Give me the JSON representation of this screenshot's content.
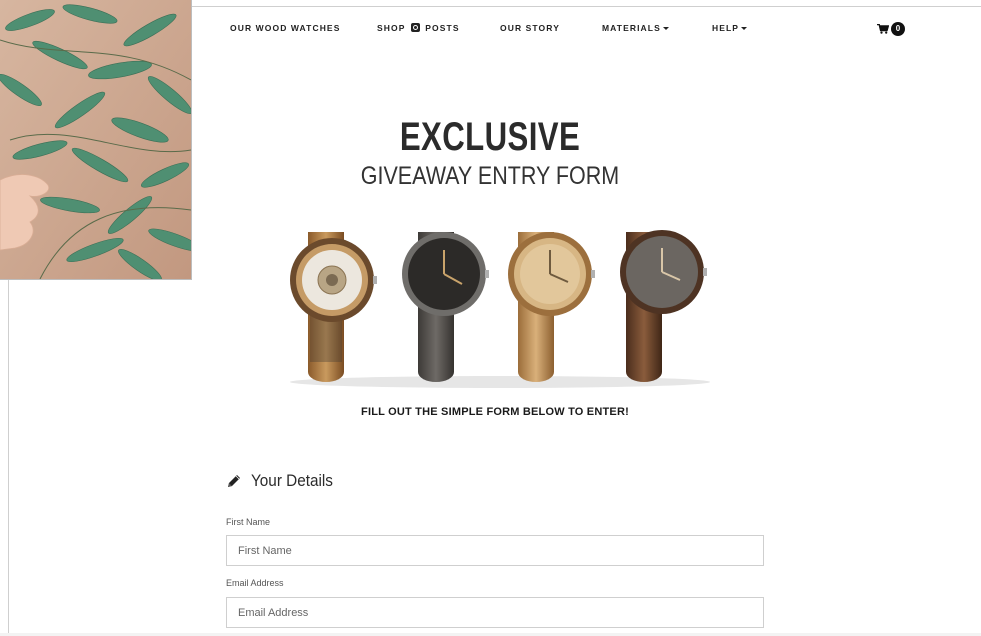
{
  "nav": {
    "items": [
      {
        "label": "OUR WOOD WATCHES"
      },
      {
        "label_pre": "SHOP",
        "label_post": "POSTS"
      },
      {
        "label": "OUR STORY"
      },
      {
        "label": "MATERIALS"
      },
      {
        "label": "HELP"
      }
    ],
    "cart_count": "0"
  },
  "hero": {
    "title": "EXCLUSIVE",
    "subtitle": "GIVEAWAY ENTRY FORM"
  },
  "cta": "FILL OUT THE SIMPLE FORM BELOW TO ENTER!",
  "form": {
    "section_title": "Your Details",
    "fields": [
      {
        "label": "First Name",
        "placeholder": "First Name",
        "value": ""
      },
      {
        "label": "Email Address",
        "placeholder": "Email Address",
        "value": ""
      }
    ]
  },
  "icons": {
    "cart": "shopping-cart-icon",
    "instagram": "instagram-icon",
    "pencil": "pencil-icon"
  }
}
